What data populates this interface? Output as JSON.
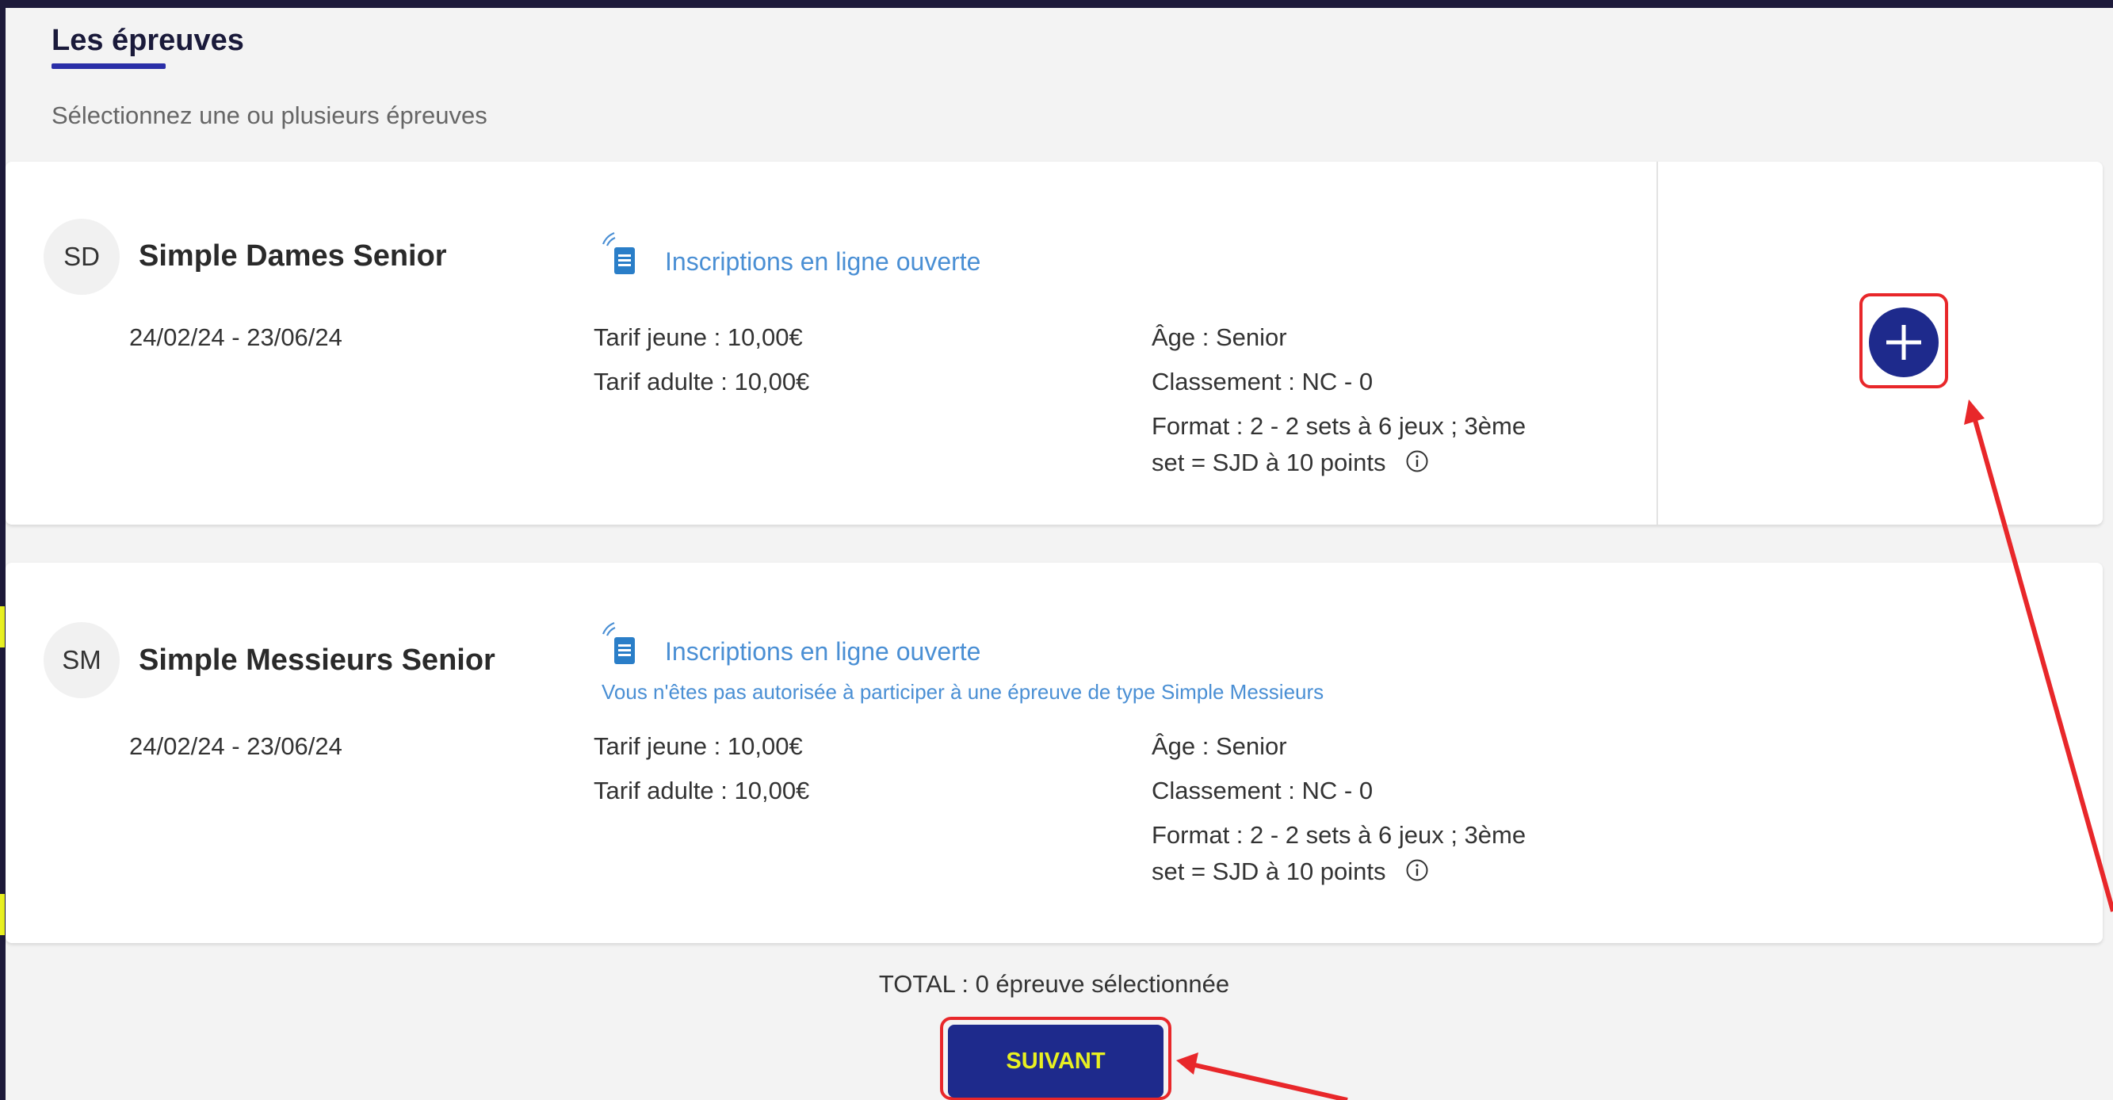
{
  "section": {
    "title": "Les épreuves",
    "subtitle": "Sélectionnez une ou plusieurs épreuves"
  },
  "events": [
    {
      "initials": "SD",
      "name": "Simple Dames Senior",
      "dates": "24/02/24 - 23/06/24",
      "status": "Inscriptions en ligne ouverte",
      "tarif_jeune": "Tarif jeune : 10,00€",
      "tarif_adulte": "Tarif adulte : 10,00€",
      "age": "Âge : Senior",
      "classement": "Classement : NC - 0",
      "format_line1": "Format : 2 - 2 sets à 6 jeux ; 3ème",
      "format_line2": "set = SJD à 10 points"
    },
    {
      "initials": "SM",
      "name": "Simple Messieurs Senior",
      "dates": "24/02/24 - 23/06/24",
      "status": "Inscriptions en ligne ouverte",
      "warning": "Vous n'êtes pas autorisée à participer à une épreuve de type Simple Messieurs",
      "tarif_jeune": "Tarif jeune : 10,00€",
      "tarif_adulte": "Tarif adulte : 10,00€",
      "age": "Âge : Senior",
      "classement": "Classement : NC - 0",
      "format_line1": "Format : 2 - 2 sets à 6 jeux ; 3ème",
      "format_line2": "set = SJD à 10 points"
    }
  ],
  "total": "TOTAL : 0 épreuve sélectionnée",
  "next_label": "SUIVANT",
  "icons": {
    "status": "online-registration-icon",
    "info": "info-circle-icon",
    "add": "plus-icon"
  },
  "colors": {
    "accent": "#1e2a8c",
    "link": "#4a8fd4",
    "highlight": "#e8272a",
    "button_text": "#e8f021",
    "frame": "#1d1a3a"
  }
}
